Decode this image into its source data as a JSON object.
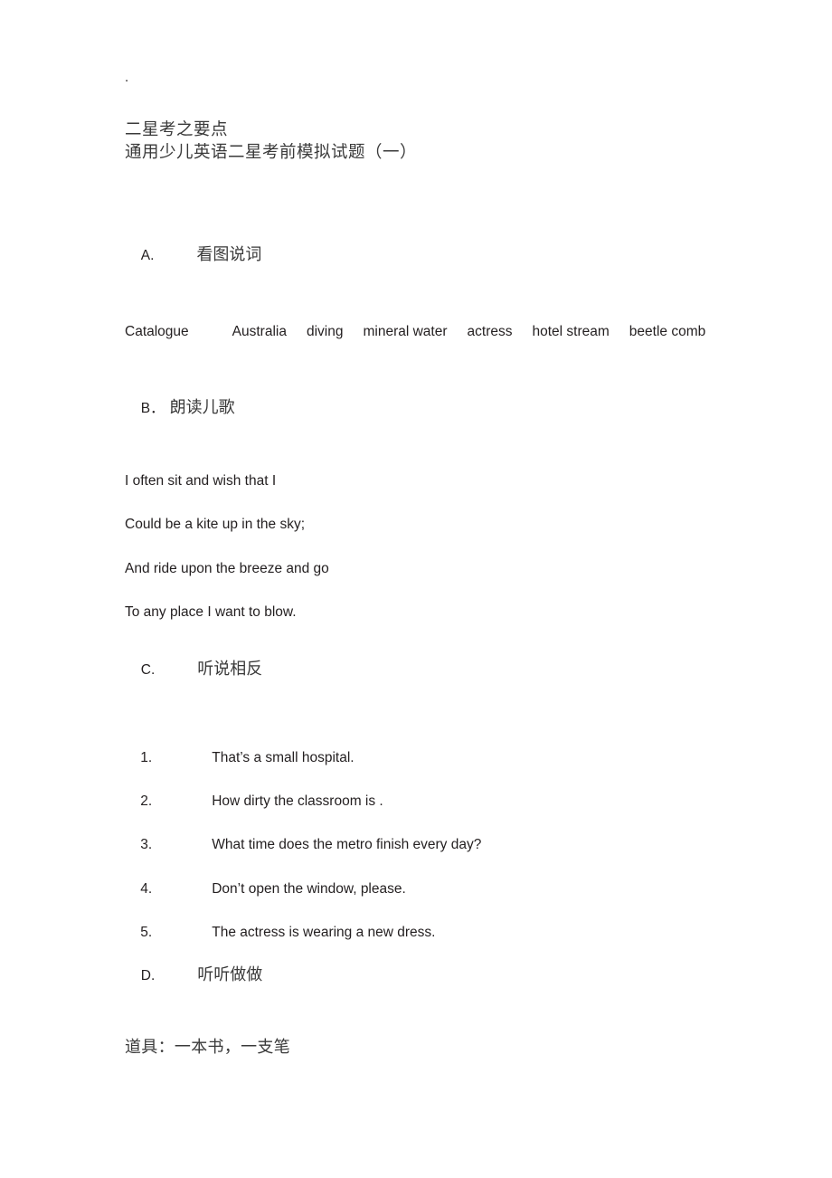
{
  "document": {
    "lead_mark": ".",
    "title_line_1": "二星考之要点",
    "title_line_2": "通用少儿英语二星考前模拟试题（一）"
  },
  "sections": {
    "a": {
      "marker": "A.",
      "label": "看图说词",
      "words": [
        "Catalogue",
        "Australia",
        "diving",
        "mineral water",
        "actress",
        "hotel stream",
        "beetle",
        "comb"
      ]
    },
    "b": {
      "marker": "B．",
      "label": "朗读儿歌",
      "rhyme": [
        "I often sit and wish that I",
        "Could be a kite up in the sky;",
        "And ride upon the breeze and go",
        "To any place I want to blow."
      ]
    },
    "c": {
      "marker": "C.",
      "label": "听说相反",
      "items": [
        {
          "number": "1.",
          "text": "That’s a small hospital."
        },
        {
          "number": "2.",
          "text": "How dirty the classroom is ."
        },
        {
          "number": "3.",
          "text": "What time does the metro finish every day?"
        },
        {
          "number": "4.",
          "text": "Don’t open the window, please."
        },
        {
          "number": "5.",
          "text": "The actress is wearing a new dress."
        }
      ]
    },
    "d": {
      "marker": "D.",
      "label": "听听做做",
      "props": "道具：一本书，一支笔"
    }
  },
  "colors": {
    "page_background": "#ffffff",
    "body_text": "#231f20",
    "cjk_text": "#3a3a3a"
  }
}
